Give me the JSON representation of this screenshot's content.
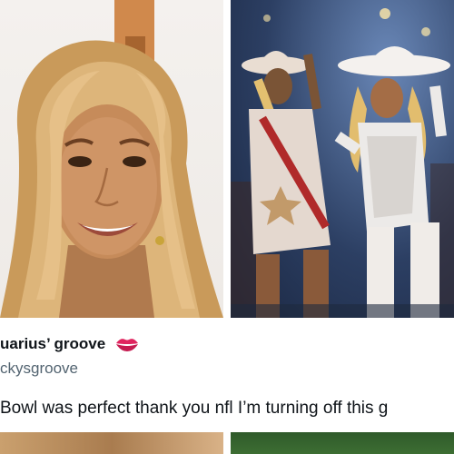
{
  "tweet": {
    "display_name": "uarius’ groove",
    "handle": "ckysgroove",
    "text": "Bowl was perfect thank you nfl I’m turning off this g"
  },
  "images": {
    "left": "smiling-woman-portrait",
    "right": "halftime-performers-in-cowboy-hats"
  },
  "icons": {
    "name_emoji": "lips-kiss-icon"
  },
  "colors": {
    "name": "#0f1419",
    "handle": "#536471",
    "lips": "#e0245e"
  }
}
